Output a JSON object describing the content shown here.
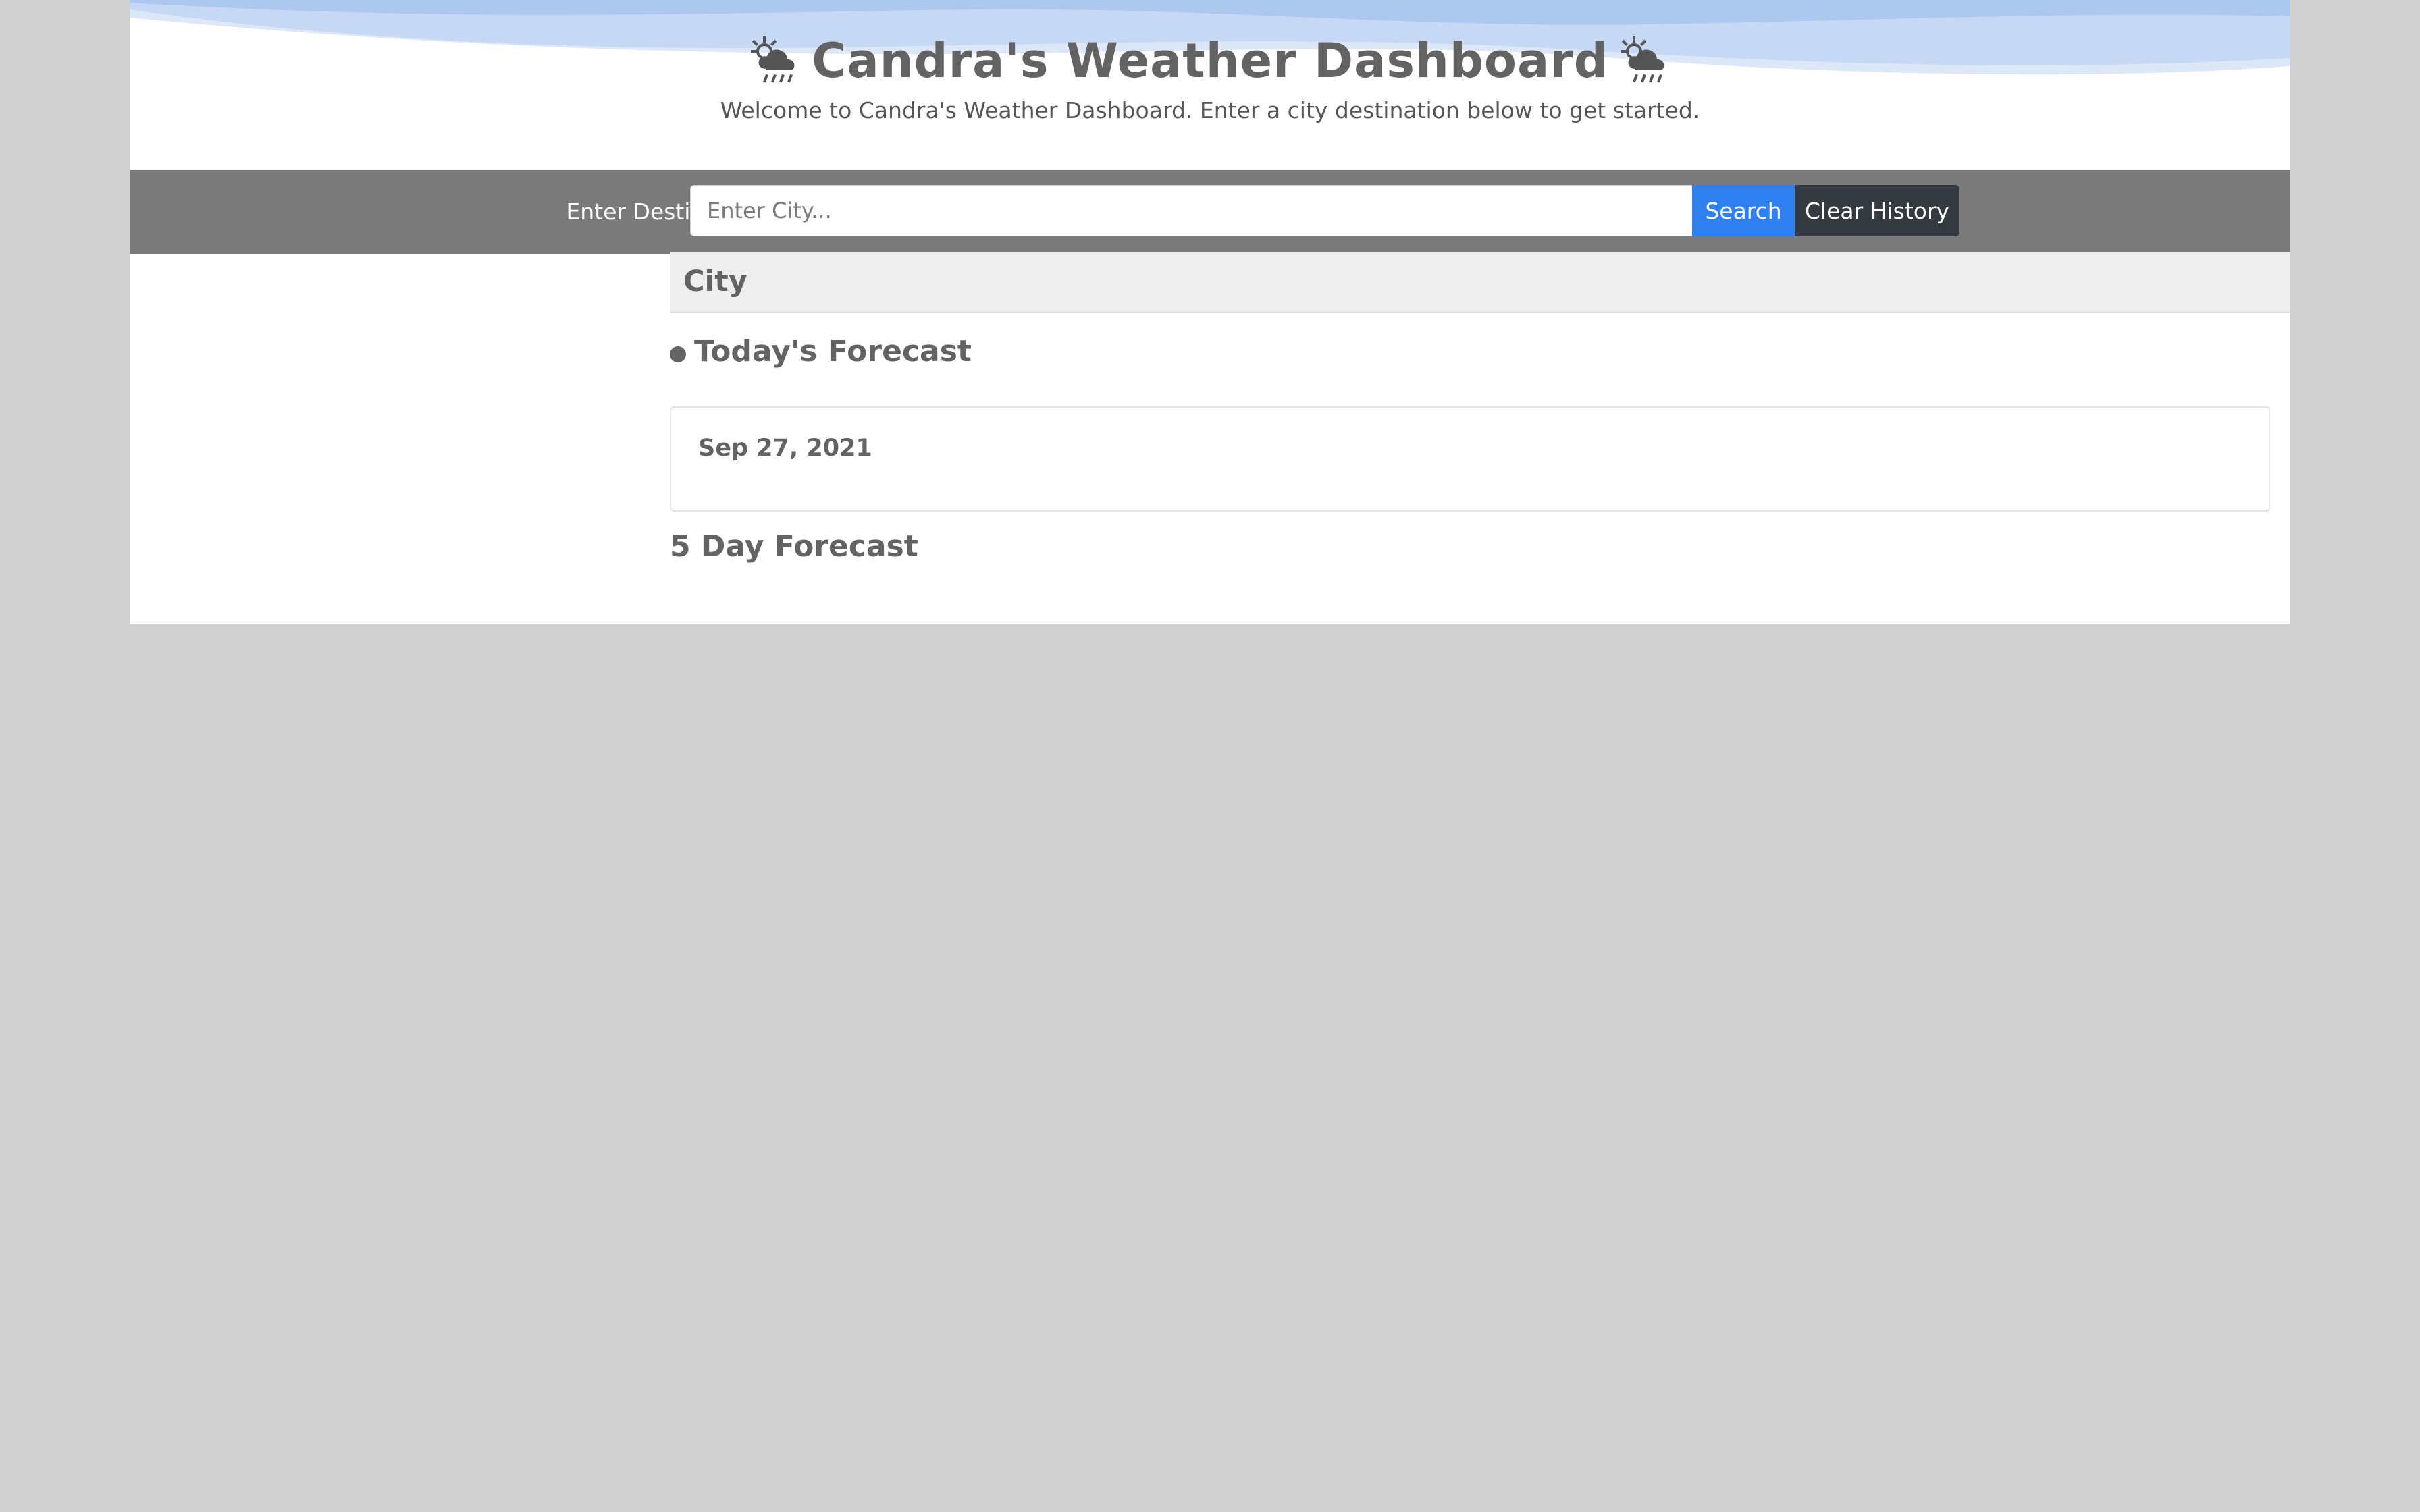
{
  "header": {
    "title": "Candra's Weather Dashboard",
    "title_icon": "cloud-sun-rain-icon",
    "subtitle": "Welcome to Candra's Weather Dashboard. Enter a city destination below to get started."
  },
  "search": {
    "label": "Enter Destination City",
    "placeholder": "Enter City...",
    "value": "",
    "search_button": "Search",
    "clear_button": "Clear History"
  },
  "main": {
    "city_title": "City",
    "today_title": "Today's Forecast",
    "today_date": "Sep 27, 2021",
    "five_day_title": "5 Day Forecast"
  },
  "colors": {
    "page_background": "#d0d0d0",
    "search_bar": "#7a7a7a",
    "search_button": "#2f7fef",
    "clear_button": "#343a40",
    "text": "#636363",
    "wave": "#a9c4ec"
  }
}
